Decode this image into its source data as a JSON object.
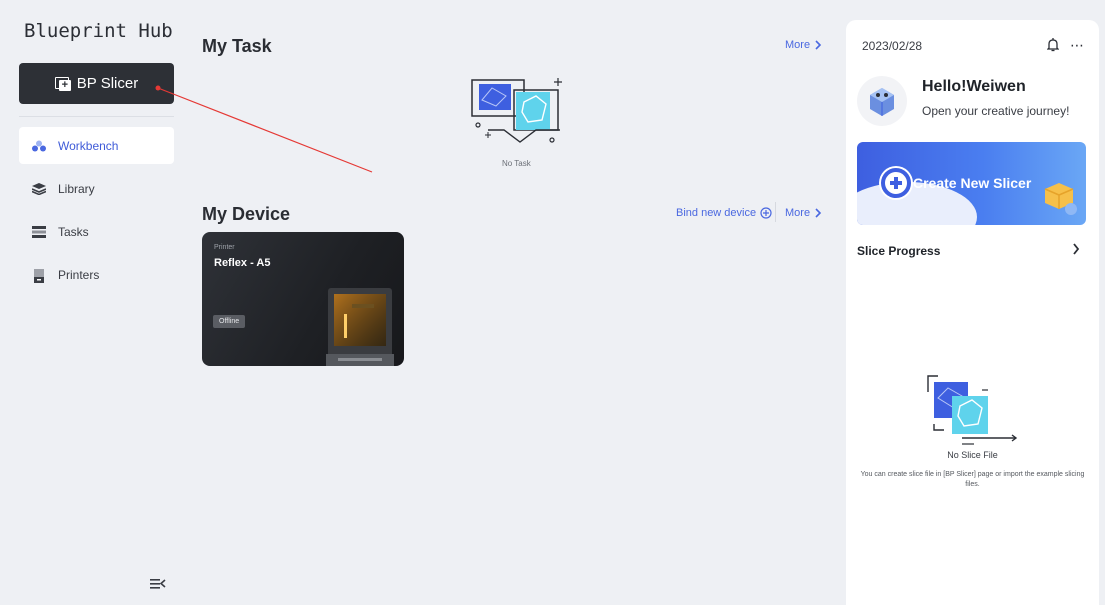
{
  "sidebar": {
    "brand": "Blueprint Hub",
    "primary_button": "BP Slicer",
    "items": [
      {
        "label": "Workbench",
        "icon": "workbench-icon",
        "active": true
      },
      {
        "label": "Library",
        "icon": "library-icon",
        "active": false
      },
      {
        "label": "Tasks",
        "icon": "tasks-icon",
        "active": false
      },
      {
        "label": "Printers",
        "icon": "printers-icon",
        "active": false
      }
    ]
  },
  "main": {
    "my_task": {
      "title": "My Task",
      "more": "More",
      "empty_text": "No Task"
    },
    "my_device": {
      "title": "My Device",
      "bind": "Bind new device",
      "more": "More",
      "devices": [
        {
          "type": "Printer",
          "name": "Reflex - A5",
          "status": "Offline"
        }
      ]
    }
  },
  "right_panel": {
    "date": "2023/02/28",
    "greeting": "Hello!Weiwen",
    "subtitle": "Open your creative journey!",
    "create_button": "Create New Slicer",
    "slice_progress": "Slice Progress",
    "empty_title": "No Slice File",
    "empty_desc": "You can create slice file in [BP Slicer] page or import the example slicing files."
  },
  "colors": {
    "accent": "#3f5bd8",
    "dark_button": "#2d3036",
    "background": "#eef0f4",
    "annotation": "#e53935"
  }
}
